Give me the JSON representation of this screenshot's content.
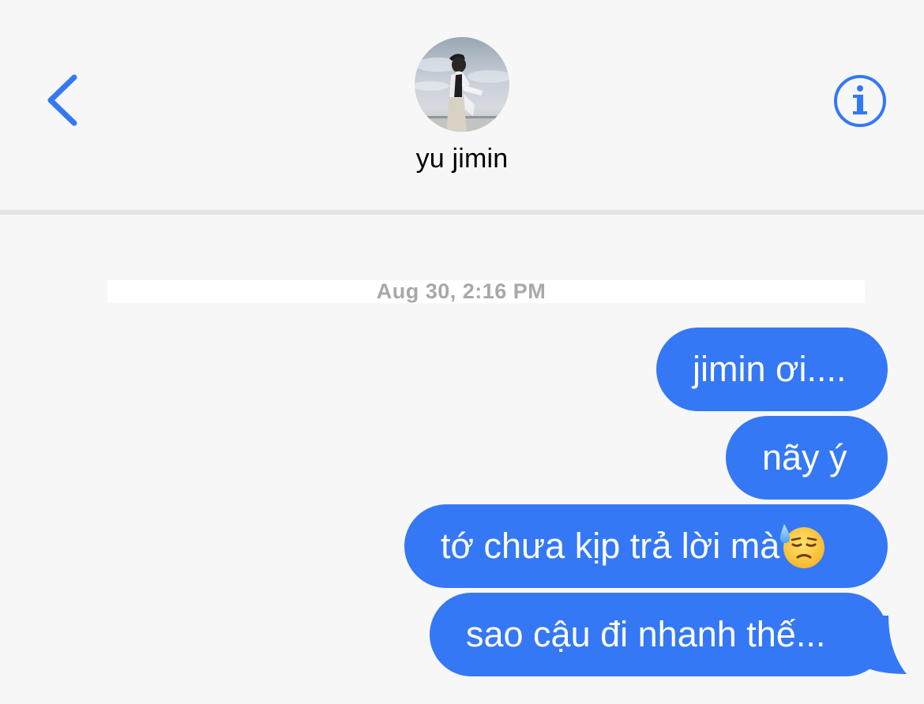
{
  "header": {
    "contact_name": "yu jimin",
    "back_icon": "chevron-left-icon",
    "info_icon": "info-icon",
    "accent_color": "#3478f6"
  },
  "thread": {
    "timestamp": "Aug 30, 2:16 PM",
    "bubble_color": "#3478f6",
    "messages": [
      {
        "text": "jimin ơi....",
        "direction": "outgoing"
      },
      {
        "text": "nãy ý",
        "direction": "outgoing"
      },
      {
        "text": "tớ chưa kịp trả lời mà",
        "emoji": "downcast-face-with-sweat-emoji",
        "direction": "outgoing"
      },
      {
        "text": "sao cậu đi nhanh thế...",
        "direction": "outgoing"
      }
    ]
  }
}
